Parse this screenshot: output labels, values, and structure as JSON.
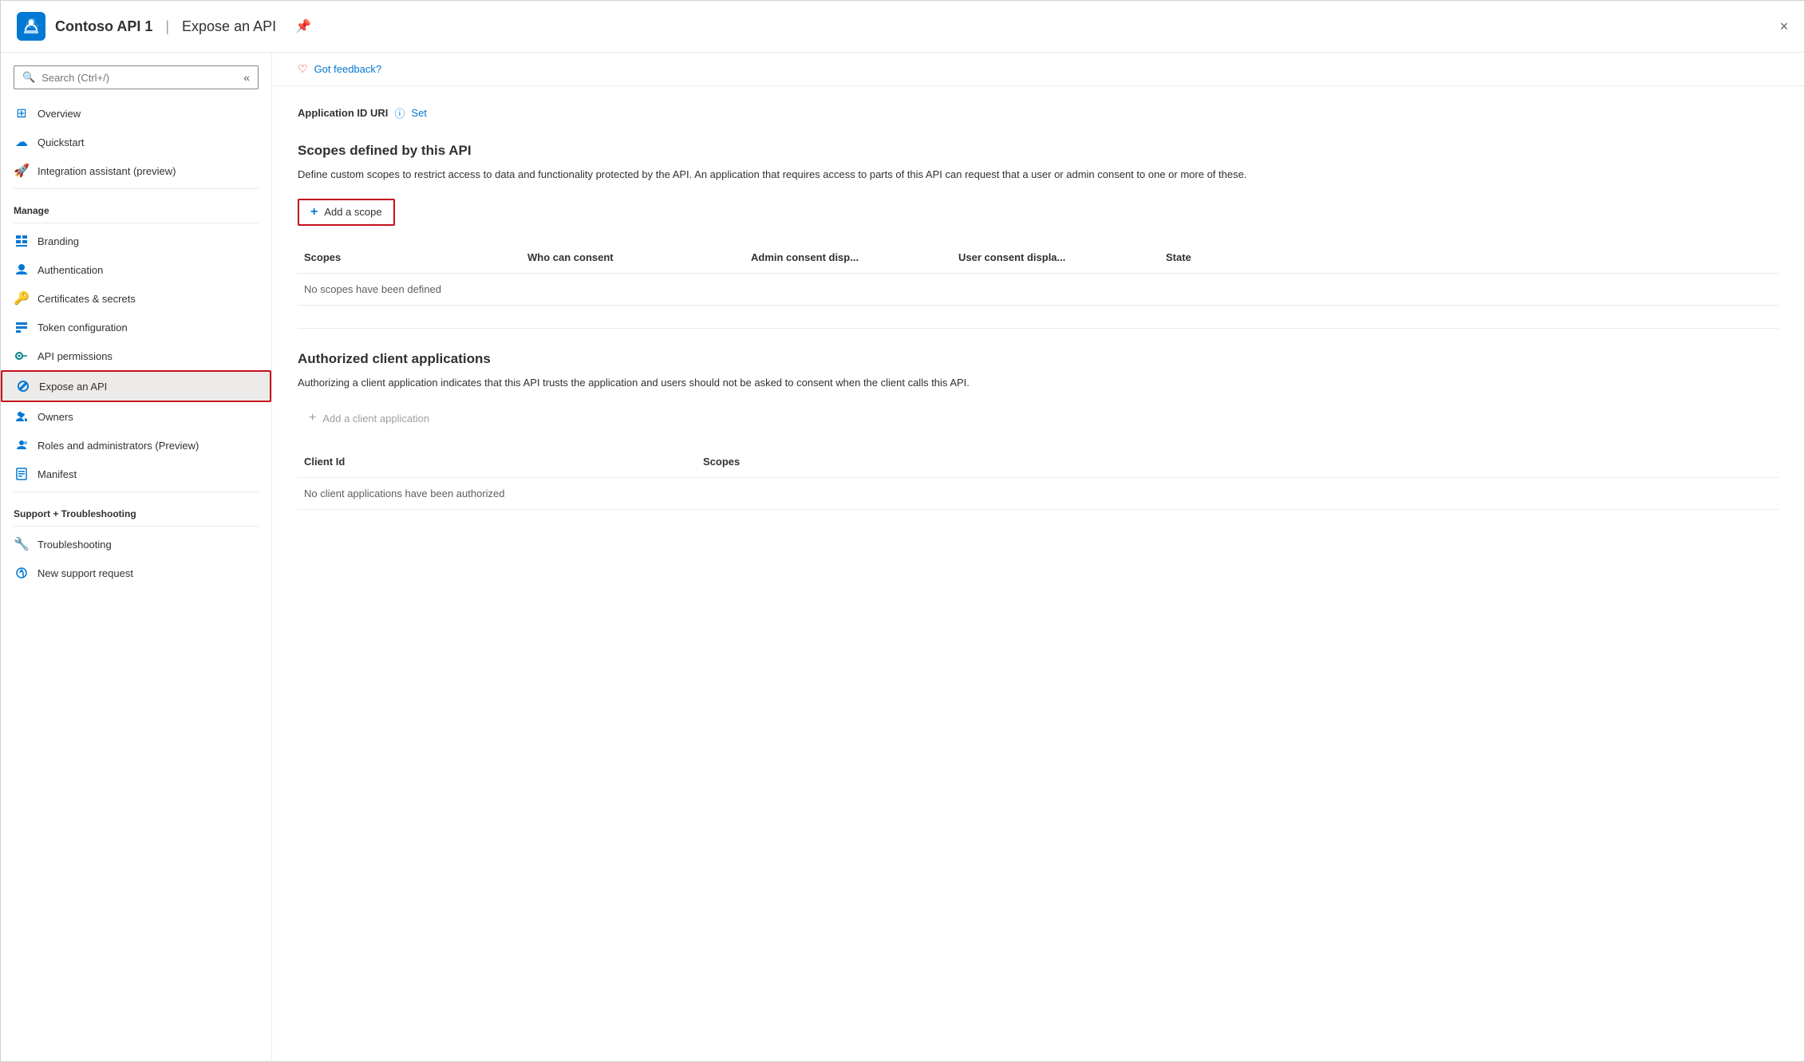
{
  "window": {
    "title": "Contoso API 1",
    "separator": "|",
    "subtitle": "Expose an API",
    "pin_tooltip": "Pin",
    "close_label": "×"
  },
  "sidebar": {
    "search_placeholder": "Search (Ctrl+/)",
    "collapse_icon": "«",
    "nav_items": [
      {
        "id": "overview",
        "label": "Overview",
        "icon": "grid"
      },
      {
        "id": "quickstart",
        "label": "Quickstart",
        "icon": "cloud"
      },
      {
        "id": "integration-assistant",
        "label": "Integration assistant (preview)",
        "icon": "rocket"
      }
    ],
    "manage_label": "Manage",
    "manage_items": [
      {
        "id": "branding",
        "label": "Branding",
        "icon": "branding"
      },
      {
        "id": "authentication",
        "label": "Authentication",
        "icon": "auth"
      },
      {
        "id": "certificates",
        "label": "Certificates & secrets",
        "icon": "cert"
      },
      {
        "id": "token-config",
        "label": "Token configuration",
        "icon": "token"
      },
      {
        "id": "api-permissions",
        "label": "API permissions",
        "icon": "api-perm"
      },
      {
        "id": "expose-api",
        "label": "Expose an API",
        "icon": "expose",
        "active": true
      },
      {
        "id": "owners",
        "label": "Owners",
        "icon": "owners"
      },
      {
        "id": "roles-admin",
        "label": "Roles and administrators (Preview)",
        "icon": "roles"
      },
      {
        "id": "manifest",
        "label": "Manifest",
        "icon": "manifest"
      }
    ],
    "support_label": "Support + Troubleshooting",
    "support_items": [
      {
        "id": "troubleshooting",
        "label": "Troubleshooting",
        "icon": "wrench"
      },
      {
        "id": "new-support",
        "label": "New support request",
        "icon": "support"
      }
    ]
  },
  "content": {
    "feedback_label": "Got feedback?",
    "app_id_label": "Application ID URI",
    "app_id_info": "ⓘ",
    "app_id_set": "Set",
    "scopes_section": {
      "title": "Scopes defined by this API",
      "description": "Define custom scopes to restrict access to data and functionality protected by the API. An application that requires access to parts of this API can request that a user or admin consent to one or more of these.",
      "add_scope_btn": "Add a scope",
      "columns": {
        "scopes": "Scopes",
        "who_can_consent": "Who can consent",
        "admin_consent_disp": "Admin consent disp...",
        "user_consent_displa": "User consent displa...",
        "state": "State"
      },
      "empty_message": "No scopes have been defined"
    },
    "authorized_section": {
      "title": "Authorized client applications",
      "description": "Authorizing a client application indicates that this API trusts the application and users should not be asked to consent when the client calls this API.",
      "add_client_btn": "Add a client application",
      "columns": {
        "client_id": "Client Id",
        "scopes": "Scopes"
      },
      "empty_message": "No client applications have been authorized"
    }
  }
}
